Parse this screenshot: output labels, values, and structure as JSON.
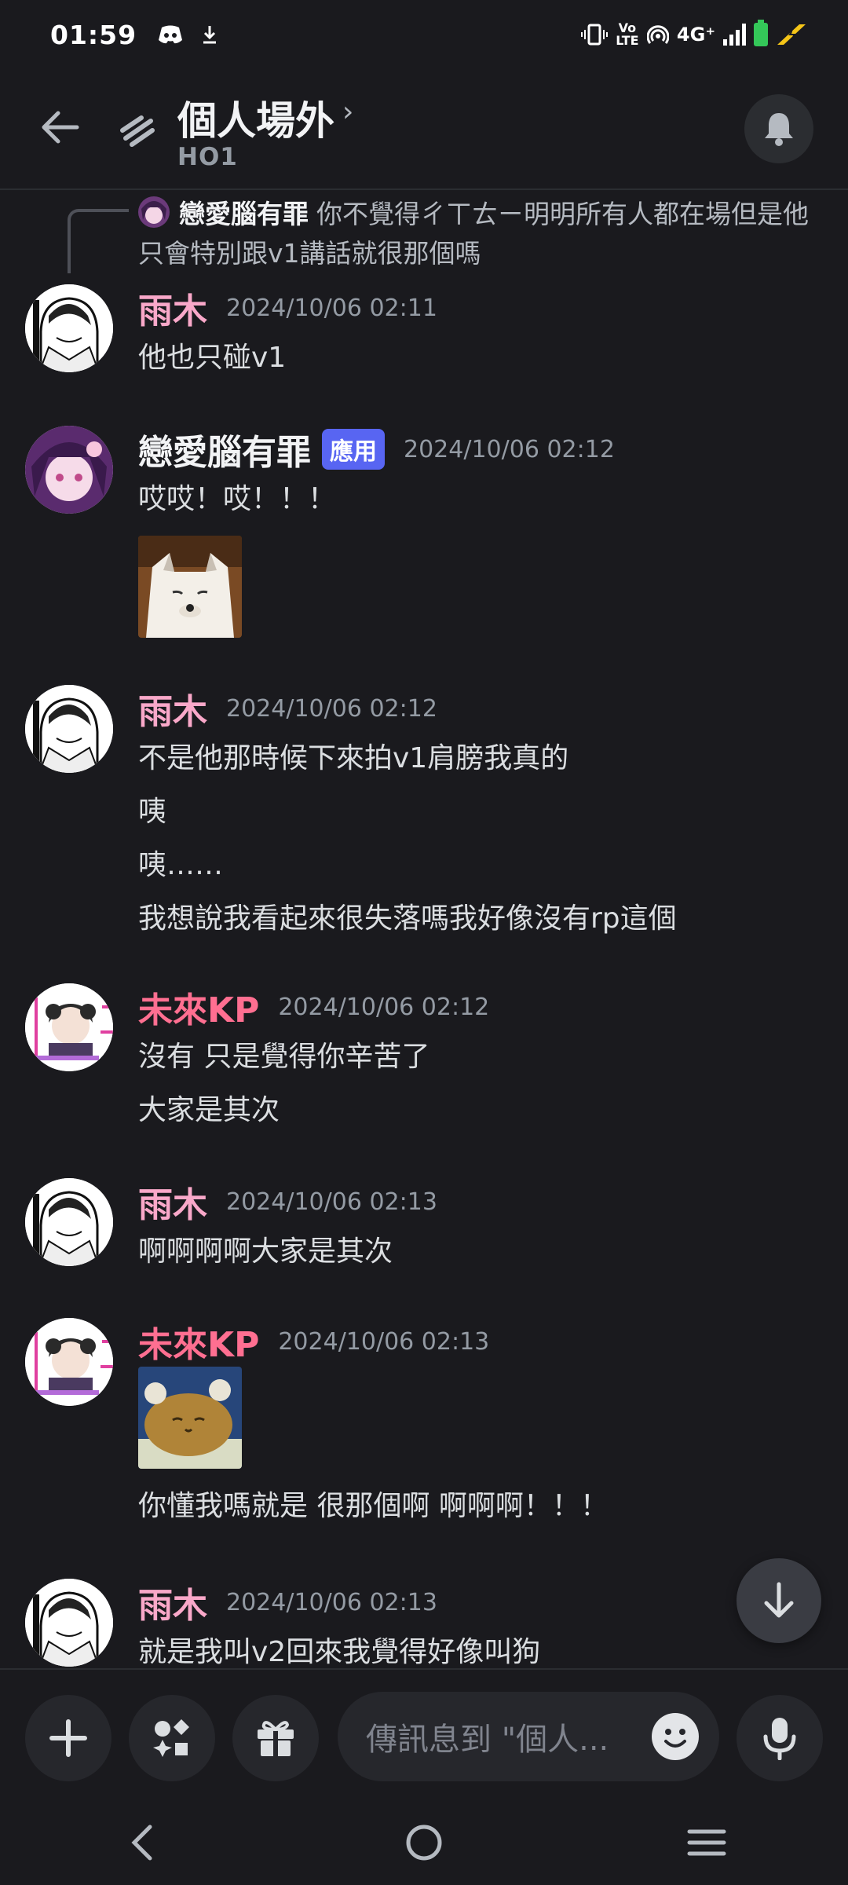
{
  "status_bar": {
    "time": "01:59",
    "network": "4G⁺",
    "volte": "Vo LTE"
  },
  "header": {
    "title": "個人場外",
    "chevron": "›",
    "subtitle": "HO1"
  },
  "reply_reference": {
    "author": "戀愛腦有罪",
    "text": "你不覺得ㄔㄒㄊㄧ明明所有人都在場但是他只會特別跟v1講話就很那個嗎"
  },
  "messages": [
    {
      "author": "雨木",
      "timestamp": "2024/10/06 02:11",
      "lines": [
        "他也只碰v1"
      ]
    },
    {
      "author": "戀愛腦有罪",
      "badge": "應用",
      "timestamp": "2024/10/06 02:12",
      "lines": [
        "哎哎！哎！！！"
      ],
      "attachment": "white-fox-image"
    },
    {
      "author": "雨木",
      "timestamp": "2024/10/06 02:12",
      "lines": [
        "不是他那時候下來拍v1肩膀我真的",
        "咦",
        "咦……",
        "我想說我看起來很失落嗎我好像沒有rp這個"
      ]
    },
    {
      "author": "未來KP",
      "timestamp": "2024/10/06 02:12",
      "lines": [
        "沒有 只是覺得你辛苦了",
        "大家是其次"
      ]
    },
    {
      "author": "雨木",
      "timestamp": "2024/10/06 02:13",
      "lines": [
        "啊啊啊啊大家是其次"
      ]
    },
    {
      "author": "未來KP",
      "timestamp": "2024/10/06 02:13",
      "attachment": "hamster-image",
      "lines": [
        "你懂我嗎就是 很那個啊 啊啊啊！！！"
      ]
    },
    {
      "author": "雨木",
      "timestamp": "2024/10/06 02:13",
      "lines": [
        "就是我叫v2回來我覺得好像叫狗"
      ]
    }
  ],
  "composer": {
    "placeholder": "傳訊息到 \"個人..."
  },
  "icons": {
    "back": "arrow-left-icon",
    "thread": "thread-icon",
    "bell": "bell-icon",
    "add": "plus-icon",
    "apps": "apps-icon",
    "gift": "gift-icon",
    "emoji": "emoji-icon",
    "mic": "microphone-icon",
    "scroll": "arrow-down-icon"
  },
  "colors": {
    "background": "#1a1a1e",
    "author_pink": "#f9a8c9",
    "author_kp": "#ff6f91",
    "badge": "#5865f2"
  }
}
